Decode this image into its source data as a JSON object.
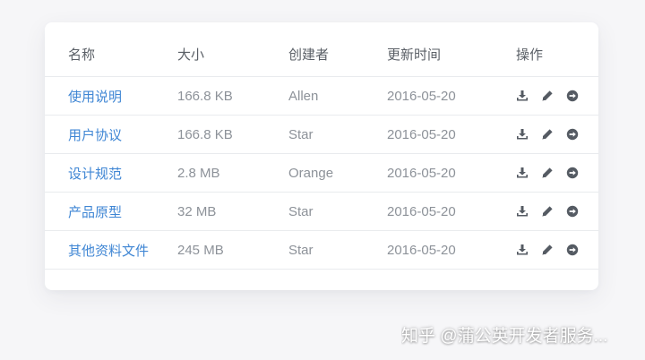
{
  "table": {
    "headers": {
      "name": "名称",
      "size": "大小",
      "creator": "创建者",
      "updated": "更新时间",
      "actions": "操作"
    },
    "rows": [
      {
        "name": "使用说明",
        "size": "166.8 KB",
        "creator": "Allen",
        "updated": "2016-05-20"
      },
      {
        "name": "用户协议",
        "size": "166.8 KB",
        "creator": "Star",
        "updated": "2016-05-20"
      },
      {
        "name": "设计规范",
        "size": "2.8 MB",
        "creator": "Orange",
        "updated": "2016-05-20"
      },
      {
        "name": "产品原型",
        "size": "32 MB",
        "creator": "Star",
        "updated": "2016-05-20"
      },
      {
        "name": "其他资料文件",
        "size": "245 MB",
        "creator": "Star",
        "updated": "2016-05-20"
      }
    ],
    "action_icons": [
      "download-icon",
      "edit-icon",
      "arrow-right-circle-icon"
    ]
  },
  "colors": {
    "link": "#3f86d4",
    "muted_text": "#8d9299",
    "header_text": "#5a5f66",
    "icon": "#555b63",
    "divider": "#e9ebee"
  },
  "watermark": "知乎 @蒲公英开发者服务..."
}
